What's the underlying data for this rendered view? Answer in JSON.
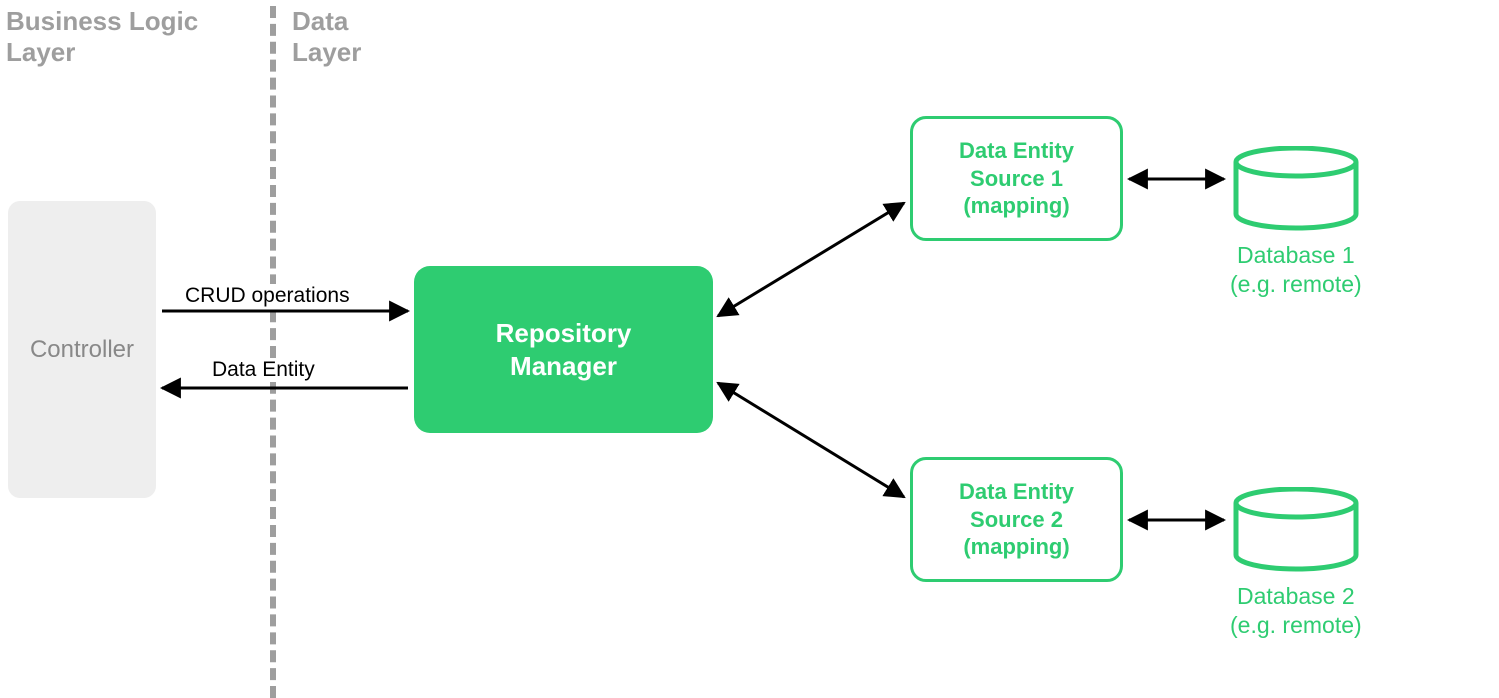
{
  "layers": {
    "business": "Business Logic\nLayer",
    "data": "Data\nLayer"
  },
  "nodes": {
    "controller": "Controller",
    "repository_manager": "Repository\nManager",
    "source1": "Data Entity\nSource 1\n(mapping)",
    "source2": "Data Entity\nSource 2\n(mapping)"
  },
  "databases": {
    "db1": "Database 1\n(e.g. remote)",
    "db2": "Database 2\n(e.g. remote)"
  },
  "edges": {
    "crud": "CRUD operations",
    "entity": "Data Entity"
  },
  "colors": {
    "green": "#2ecc71",
    "gray": "#9e9e9e",
    "lightgray": "#eeeeee"
  }
}
